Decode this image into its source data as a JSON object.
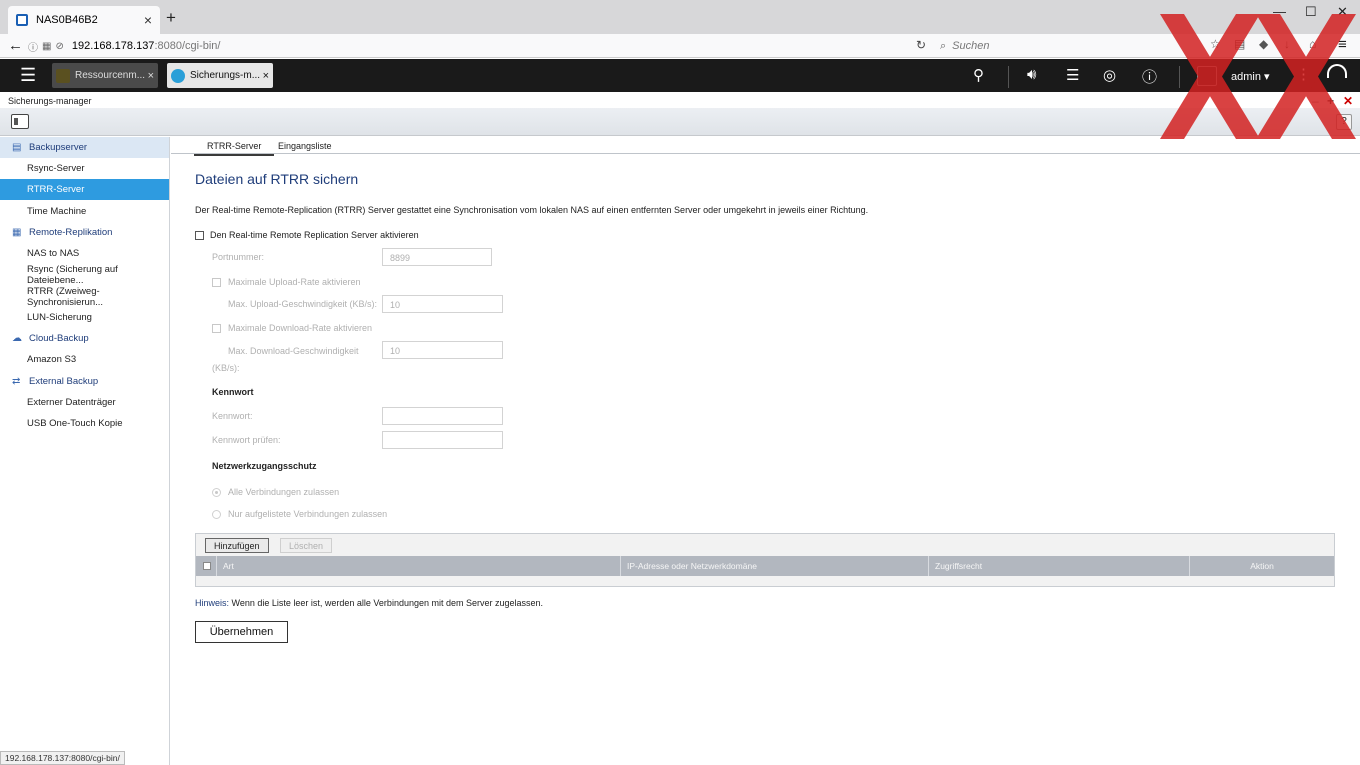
{
  "browser": {
    "tab_title": "NAS0B46B2",
    "url_host": "192.168.178.137",
    "url_rest": ":8080/cgi-bin/",
    "search_placeholder": "Suchen",
    "status_url": "192.168.178.137:8080/cgi-bin/"
  },
  "qts": {
    "tabs": [
      {
        "label": "Ressourcenm..."
      },
      {
        "label": "Sicherungs-m..."
      }
    ],
    "user": "admin ▾"
  },
  "app": {
    "title": "Sicherungs-manager",
    "help": "?"
  },
  "sidebar": {
    "groups": [
      {
        "label": "Backupserver",
        "icon": "server-icon",
        "items": [
          "Rsync-Server",
          "RTRR-Server",
          "Time Machine"
        ]
      },
      {
        "label": "Remote-Replikation",
        "icon": "replication-icon",
        "items": [
          "NAS to NAS",
          "Rsync (Sicherung auf Dateiebene...",
          "RTRR (Zweiweg-Synchronisierun...",
          "LUN-Sicherung"
        ]
      },
      {
        "label": "Cloud-Backup",
        "icon": "cloud-icon",
        "items": [
          "Amazon S3"
        ]
      },
      {
        "label": "External Backup",
        "icon": "sync-icon",
        "items": [
          "Externer Datenträger",
          "USB One-Touch Kopie"
        ]
      }
    ],
    "selected": "RTRR-Server"
  },
  "content": {
    "tabs": [
      "RTRR-Server",
      "Eingangsliste"
    ],
    "heading": "Dateien auf RTRR sichern",
    "description": "Der Real-time Remote-Replication (RTRR) Server gestattet eine Synchronisation vom lokalen NAS auf einen entfernten Server oder umgekehrt in jeweils einer Richtung.",
    "enable_label": "Den Real-time Remote Replication Server aktivieren",
    "port_label": "Portnummer:",
    "port_value": "8899",
    "max_upload_label": "Maximale Upload-Rate aktivieren",
    "upload_speed_label": "Max. Upload-Geschwindigkeit (KB/s):",
    "upload_speed_value": "10",
    "max_download_label": "Maximale Download-Rate aktivieren",
    "download_speed_label_1": "Max. Download-Geschwindigkeit",
    "download_speed_label_2": "(KB/s):",
    "download_speed_value": "10",
    "password_section": "Kennwort",
    "password_label": "Kennwort:",
    "password_confirm_label": "Kennwort prüfen:",
    "network_section": "Netzwerkzugangsschutz",
    "radio_all": "Alle Verbindungen zulassen",
    "radio_listed": "Nur aufgelistete Verbindungen zulassen",
    "add_button": "Hinzufügen",
    "delete_button": "Löschen",
    "columns": [
      "Art",
      "IP-Adresse oder Netzwerkdomäne",
      "Zugriffsrecht",
      "Aktion"
    ],
    "hint_key": "Hinweis:",
    "hint_text": " Wenn die Liste leer ist, werden alle Verbindungen mit dem Server zugelassen.",
    "apply_button": "Übernehmen"
  }
}
